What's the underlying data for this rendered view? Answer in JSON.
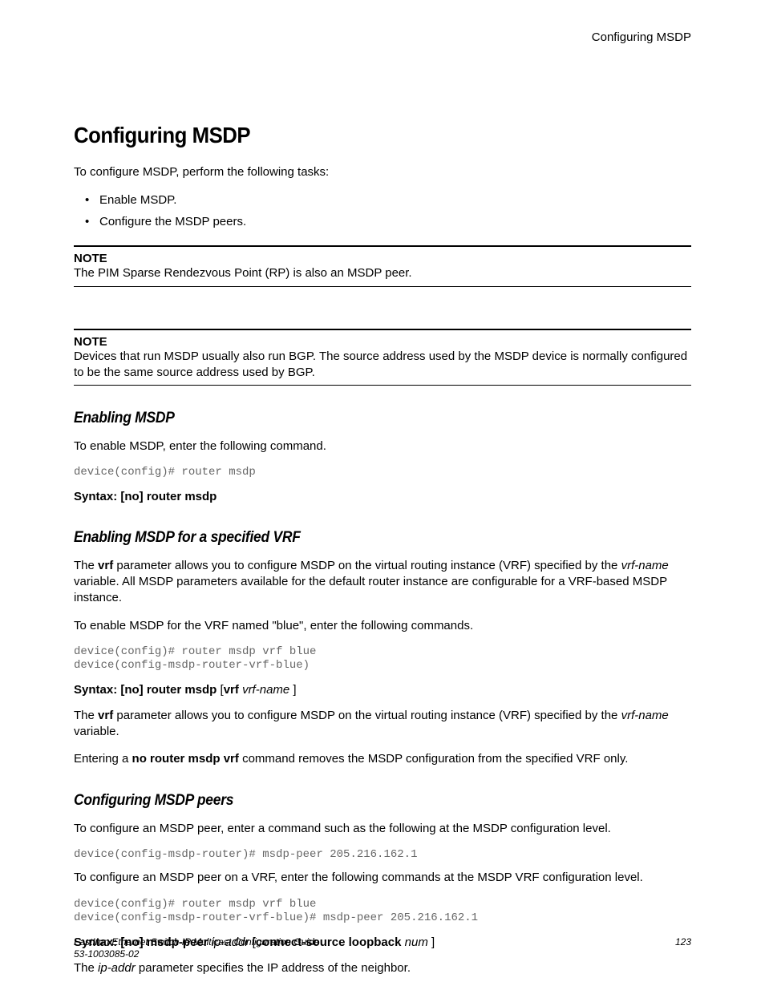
{
  "running_header": "Configuring MSDP",
  "title": "Configuring MSDP",
  "intro": "To configure MSDP, perform the following tasks:",
  "bullets": [
    "Enable MSDP.",
    "Configure the MSDP peers."
  ],
  "notes": [
    {
      "label": "NOTE",
      "text": "The PIM Sparse Rendezvous Point (RP) is also an MSDP peer."
    },
    {
      "label": "NOTE",
      "text": "Devices that run MSDP usually also run BGP. The source address used by the MSDP device is normally configured to be the same source address used by BGP."
    }
  ],
  "sect1": {
    "title": "Enabling MSDP",
    "p1": "To enable MSDP, enter the following command.",
    "code1": "device(config)# router msdp",
    "syntax1_prefix": "Syntax: [no] router msdp"
  },
  "sect2": {
    "title": "Enabling MSDP for a specified VRF",
    "p1_a": "The ",
    "p1_b": "vrf",
    "p1_c": " parameter allows you to configure MSDP on the virtual routing instance (VRF) specified by the ",
    "p1_d": "vrf-name",
    "p1_e": " variable. All MSDP parameters available for the default router instance are configurable for a VRF-based MSDP instance.",
    "p2": "To enable MSDP for the VRF named \"blue\", enter the following commands.",
    "code1": "device(config)# router msdp vrf blue\ndevice(config-msdp-router-vrf-blue)",
    "syntax_a": "Syntax: [no] router msdp",
    "syntax_b": " [",
    "syntax_c": "vrf",
    "syntax_d": " ",
    "syntax_e": "vrf-name",
    "syntax_f": " ]",
    "p3_a": "The ",
    "p3_b": "vrf",
    "p3_c": " parameter allows you to configure MSDP on the virtual routing instance (VRF) specified by the ",
    "p3_d": "vrf-name",
    "p3_e": " variable.",
    "p4_a": "Entering a ",
    "p4_b": "no router msdp vrf",
    "p4_c": " command removes the MSDP configuration from the specified VRF only."
  },
  "sect3": {
    "title": "Configuring MSDP peers",
    "p1": "To configure an MSDP peer, enter a command such as the following at the MSDP configuration level.",
    "code1": "device(config-msdp-router)# msdp-peer 205.216.162.1",
    "p2": "To configure an MSDP peer on a VRF, enter the following commands at the MSDP VRF configuration level.",
    "code2": "device(config)# router msdp vrf blue\ndevice(config-msdp-router-vrf-blue)# msdp-peer 205.216.162.1",
    "syntax_a": "Syntax: [no] msdp-peer",
    "syntax_b": " ",
    "syntax_c": "ip-addr",
    "syntax_d": " [",
    "syntax_e": "connect-source loopback",
    "syntax_f": " ",
    "syntax_g": "num",
    "syntax_h": " ]",
    "p3_a": "The ",
    "p3_b": "ip-addr",
    "p3_c": " parameter specifies the IP address of the neighbor."
  },
  "footer": {
    "doc_title": "FastIron Ethernet Switch IP Multicast Configuration Guide",
    "doc_num": "53-1003085-02",
    "page": "123"
  }
}
